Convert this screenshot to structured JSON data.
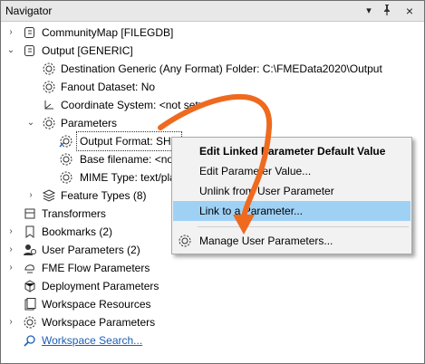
{
  "window": {
    "title": "Navigator",
    "controls": [
      "▾",
      "×"
    ]
  },
  "tree": {
    "community_map": "CommunityMap [FILEGDB]",
    "output": "Output [GENERIC]",
    "destination": "Destination Generic (Any Format) Folder: C:\\FMEData2020\\Output",
    "fanout": "Fanout Dataset: No",
    "coordinate_system": "Coordinate System: <not set>",
    "parameters": "Parameters",
    "output_format": "Output Format: SHA",
    "base_filename": "Base filename: <not",
    "mime_type": "MIME Type: text/pla",
    "feature_types": "Feature Types (8)",
    "transformers": "Transformers",
    "bookmarks": "Bookmarks (2)",
    "user_parameters": "User Parameters (2)",
    "fme_flow_parameters": "FME Flow Parameters",
    "deployment_parameters": "Deployment Parameters",
    "workspace_resources": "Workspace Resources",
    "workspace_parameters": "Workspace Parameters",
    "workspace_search": "Workspace Search..."
  },
  "context_menu": {
    "edit_linked_default": "Edit Linked Parameter Default Value",
    "edit_parameter_value": "Edit Parameter Value...",
    "unlink": "Unlink from User Parameter",
    "link_to_parameter": "Link to a Parameter...",
    "manage_user_parameters": "Manage User Parameters..."
  },
  "colors": {
    "highlight": "#9fd1f5",
    "annotation_arrow": "#ee6a1f",
    "link": "#1a5fb4"
  }
}
